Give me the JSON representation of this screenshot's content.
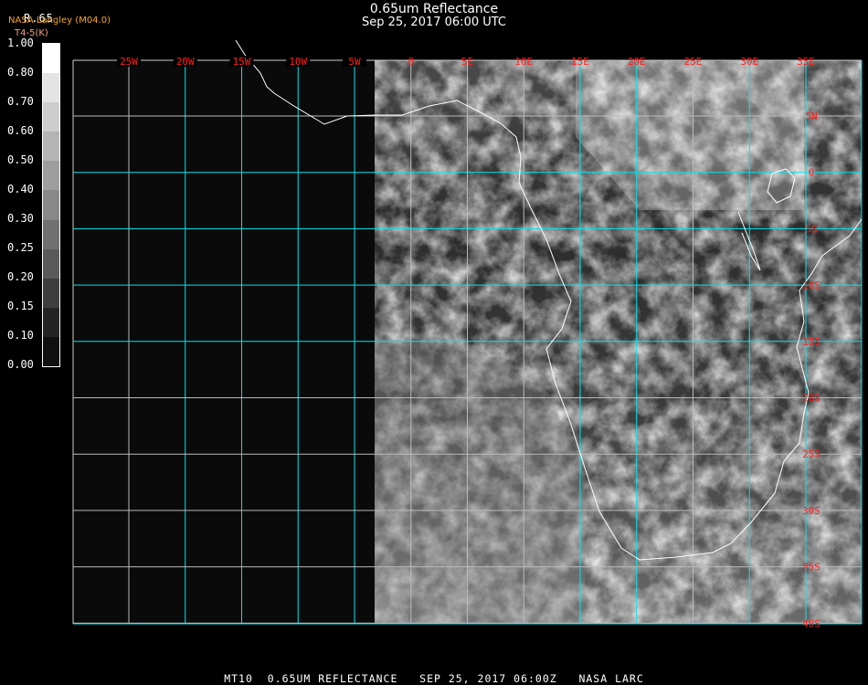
{
  "header": {
    "title": "0.65um Reflectance",
    "subtitle": "Sep 25, 2017 06:00 UTC"
  },
  "legend": {
    "band": "R.65",
    "source": "NASA Langley (M04.0)",
    "band_secondary": "T4-5(K)",
    "tick_labels": [
      "1.00",
      "0.80",
      "0.70",
      "0.60",
      "0.50",
      "0.40",
      "0.30",
      "0.25",
      "0.20",
      "0.15",
      "0.10",
      "0.00"
    ],
    "colors": [
      "#ffffff",
      "#e4e4e4",
      "#cdcdcd",
      "#b4b4b4",
      "#9e9e9e",
      "#888888",
      "#707070",
      "#5a5a5a",
      "#3e3e3e",
      "#242424",
      "#101010"
    ]
  },
  "map": {
    "longitude_labels": [
      "25W",
      "20W",
      "15W",
      "10W",
      "5W",
      "0",
      "5E",
      "10E",
      "15E",
      "20E",
      "25E",
      "30E",
      "35E"
    ],
    "latitude_labels": [
      "5N",
      "0",
      "5S",
      "10S",
      "15S",
      "20S",
      "25S",
      "30S",
      "35S",
      "40S"
    ],
    "grid_color": "#00e5ee",
    "label_color": "#ff2020",
    "coast_color": "#ffffff"
  },
  "footer": {
    "text": "MT10  0.65UM REFLECTANCE   SEP 25, 2017 06:00Z   NASA LARC"
  }
}
